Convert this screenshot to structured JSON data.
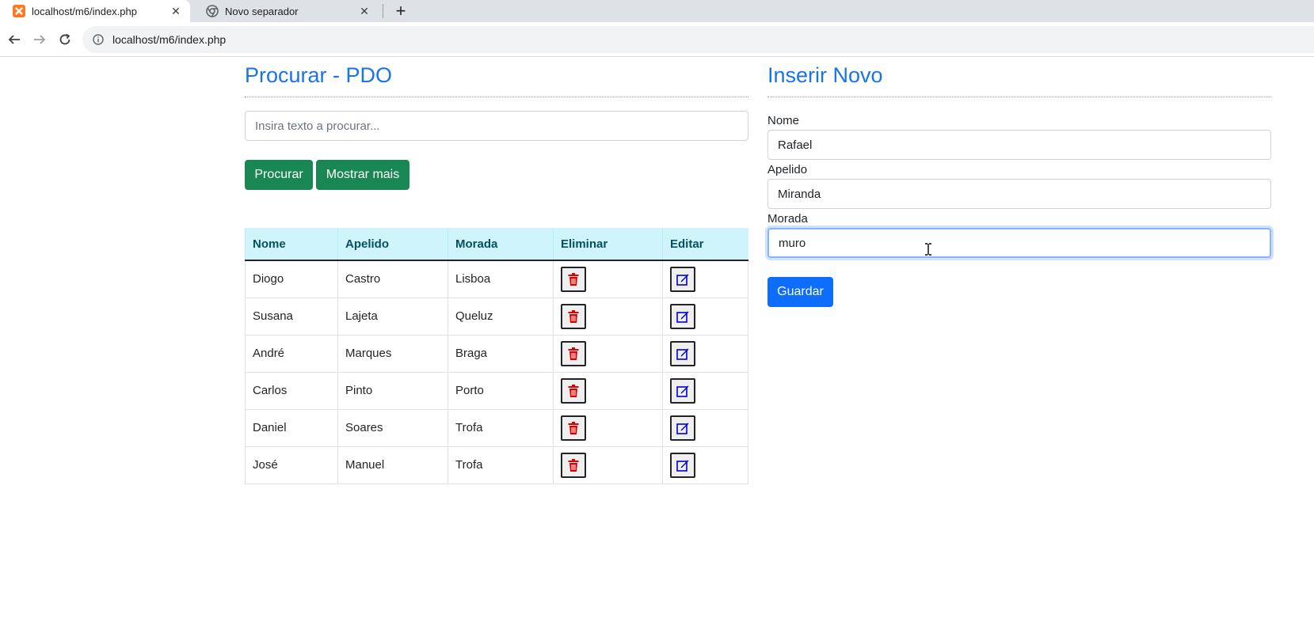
{
  "browser": {
    "tabs": [
      {
        "title": "localhost/m6/index.php",
        "active": true
      },
      {
        "title": "Novo separador",
        "active": false
      }
    ],
    "url": "localhost/m6/index.php"
  },
  "search_panel": {
    "heading": "Procurar - PDO",
    "search_placeholder": "Insira texto a procurar...",
    "search_value": "",
    "search_button": "Procurar",
    "more_button": "Mostrar mais",
    "table": {
      "headers": [
        "Nome",
        "Apelido",
        "Morada",
        "Eliminar",
        "Editar"
      ],
      "rows": [
        {
          "nome": "Diogo",
          "apelido": "Castro",
          "morada": "Lisboa"
        },
        {
          "nome": "Susana",
          "apelido": "Lajeta",
          "morada": "Queluz"
        },
        {
          "nome": "André",
          "apelido": "Marques",
          "morada": "Braga"
        },
        {
          "nome": "Carlos",
          "apelido": "Pinto",
          "morada": "Porto"
        },
        {
          "nome": "Daniel",
          "apelido": "Soares",
          "morada": "Trofa"
        },
        {
          "nome": "José",
          "apelido": "Manuel",
          "morada": "Trofa"
        }
      ]
    }
  },
  "insert_panel": {
    "heading": "Inserir Novo",
    "nome_label": "Nome",
    "nome_value": "Rafael",
    "apelido_label": "Apelido",
    "apelido_value": "Miranda",
    "morada_label": "Morada",
    "morada_value": "muro",
    "save_button": "Guardar"
  },
  "colors": {
    "heading": "#1a73e8",
    "green_button": "#198754",
    "blue_button": "#0d6efd",
    "table_header_bg": "#cff4fc",
    "delete_icon": "#dc0000",
    "edit_icon": "#0000cc"
  },
  "icons": {
    "delete": "trash-icon",
    "edit": "edit-icon"
  }
}
